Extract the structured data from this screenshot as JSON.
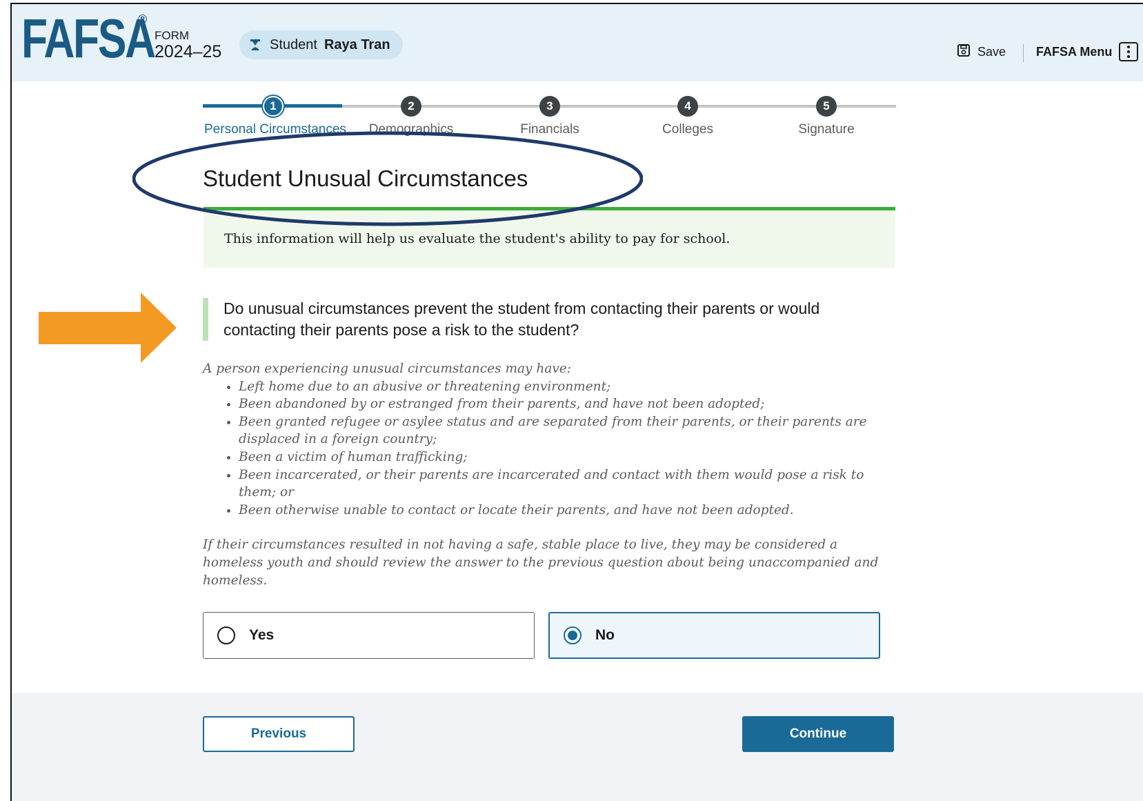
{
  "header": {
    "logo": "FAFSA",
    "reg_mark": "®",
    "form_label": "FORM",
    "form_year": "2024–25",
    "student_label": "Student",
    "student_name": "Raya Tran",
    "save_label": "Save",
    "menu_label": "FAFSA Menu",
    "icons": {
      "student": "graduation-cap-icon",
      "save": "floppy-disk-icon",
      "menu": "kebab-menu-icon"
    }
  },
  "stepper": {
    "current_step": 1,
    "steps": [
      {
        "num": "1",
        "label": "Personal Circumstances"
      },
      {
        "num": "2",
        "label": "Demographics"
      },
      {
        "num": "3",
        "label": "Financials"
      },
      {
        "num": "4",
        "label": "Colleges"
      },
      {
        "num": "5",
        "label": "Signature"
      }
    ]
  },
  "page": {
    "title": "Student Unusual Circumstances",
    "info_text": "This information will help us evaluate the student's ability to pay for school."
  },
  "question": {
    "text": "Do unusual circumstances prevent the student from contacting their parents or would contacting their parents pose a risk to the student?",
    "hint_intro": "A person experiencing unusual circumstances may have:",
    "hint_items": [
      "Left home due to an abusive or threatening environment;",
      "Been abandoned by or estranged from their parents, and have not been adopted;",
      "Been granted refugee or asylee status and are separated from their parents, or their parents are displaced in a foreign country;",
      "Been a victim of human trafficking;",
      "Been incarcerated, or their parents are incarcerated and contact with them would pose a risk to them; or",
      "Been otherwise unable to contact or locate their parents, and have not been adopted."
    ],
    "hint_note": "If their circumstances resulted in not having a safe, stable place to live, they may be considered a homeless youth and should review the answer to the previous question about being unaccompanied and homeless.",
    "options": [
      {
        "label": "Yes",
        "selected": false
      },
      {
        "label": "No",
        "selected": true
      }
    ]
  },
  "footer": {
    "previous_label": "Previous",
    "continue_label": "Continue"
  },
  "annotations": {
    "oval_color": "#1f3a6a",
    "arrow_color": "#f39a25"
  },
  "colors": {
    "brand": "#1a5a84",
    "primary": "#1a6a98",
    "success_border": "#3cac3a"
  }
}
